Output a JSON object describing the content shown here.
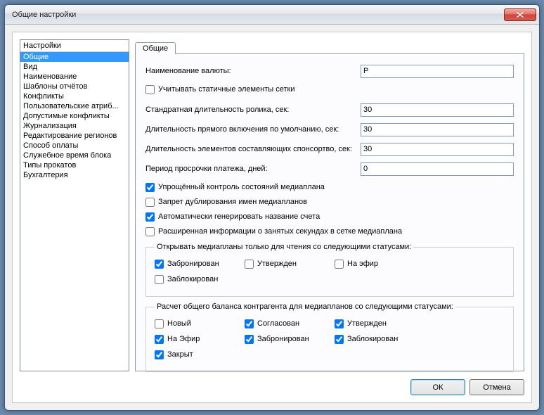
{
  "window": {
    "title": "Общие настройки"
  },
  "sidebar": {
    "header": "Настройки",
    "items": [
      "Общие",
      "Вид",
      "Наименование",
      "Шаблоны отчётов",
      "Конфликты",
      "Пользовательские атриб...",
      "Допустимые конфликты",
      "Журнализация",
      "Редактирование регионов",
      "Способ оплаты",
      "Служебное время блока",
      "Типы прокатов",
      "Бухгалтерия"
    ],
    "selected_index": 0
  },
  "tabs": {
    "active": "Общие"
  },
  "form": {
    "currency_label": "Наименование валюты:",
    "currency_value": "Р",
    "static_elements_label": "Учитывать статичные элементы сетки",
    "static_elements_checked": false,
    "std_duration_label": "Стандратная длительность ролика, сек:",
    "std_duration_value": "30",
    "live_duration_label": "Длительность прямого включения по умолчанию, сек:",
    "live_duration_value": "30",
    "sponsor_duration_label": "Длительность элементов составляющих спонсортво, сек:",
    "sponsor_duration_value": "30",
    "overdue_label": "Период просрочки платежа, дней:",
    "overdue_value": "0",
    "simplified_label": "Упрощённый контроль состояний медиаплана",
    "simplified_checked": true,
    "duplicate_label": "Запрет дублирования имен медиапланов",
    "duplicate_checked": false,
    "autogen_label": "Автоматически генерировать название счета",
    "autogen_checked": true,
    "extended_label": "Расширенная информации о занятых секундах в сетке медиаплана",
    "extended_checked": false
  },
  "readonly_group": {
    "legend": "Открывать медиапланы только для чтения со следующими статусами:",
    "items": [
      {
        "label": "Забронирован",
        "checked": true
      },
      {
        "label": "Утвержден",
        "checked": false
      },
      {
        "label": "На эфир",
        "checked": false
      },
      {
        "label": "Заблокирован",
        "checked": false
      }
    ]
  },
  "balance_group": {
    "legend": "Расчет общего баланса контрагента для медиапланов со следующими статусами:",
    "items": [
      {
        "label": "Новый",
        "checked": false
      },
      {
        "label": "Согласован",
        "checked": true
      },
      {
        "label": "Утвержден",
        "checked": true
      },
      {
        "label": "На Эфир",
        "checked": true
      },
      {
        "label": "Забронирован",
        "checked": true
      },
      {
        "label": "Заблокирован",
        "checked": true
      },
      {
        "label": "Закрыт",
        "checked": true
      }
    ]
  },
  "buttons": {
    "ok": "ОК",
    "cancel": "Отмена"
  }
}
